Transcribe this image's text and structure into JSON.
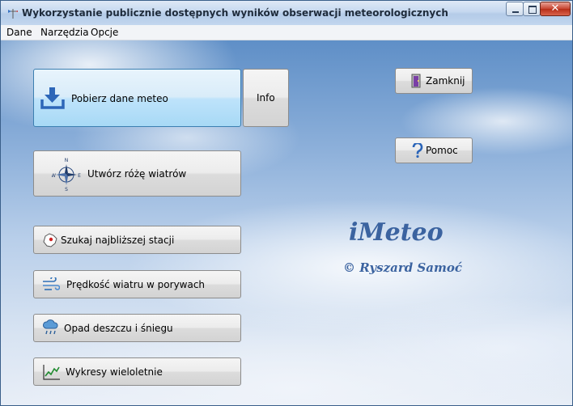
{
  "window": {
    "title": "Wykorzystanie  publicznie dostępnych wyników obserwacji meteorologicznych",
    "close_label": "✕"
  },
  "menu": {
    "items": [
      "Dane",
      "Narzędzia",
      "Opcje"
    ]
  },
  "buttons": {
    "download": "Pobierz dane meteo",
    "info": "Info",
    "windrose": "Utwórz różę wiatrów",
    "nearest_station": "Szukaj najbliższej stacji",
    "gust_speed": "Prędkość wiatru w porywach",
    "precipitation": "Opad deszczu i śniegu",
    "charts": "Wykresy wieloletnie",
    "close": "Zamknij",
    "help": "Pomoc"
  },
  "compass": {
    "n": "N",
    "s": "S",
    "e": "E",
    "w": "W"
  },
  "branding": {
    "app_name": "iMeteo",
    "author": "© Ryszard Samoć"
  },
  "colors": {
    "accent": "#3b63a0",
    "selected_button": "#bee3fb",
    "download_icon": "#2d66b8"
  }
}
